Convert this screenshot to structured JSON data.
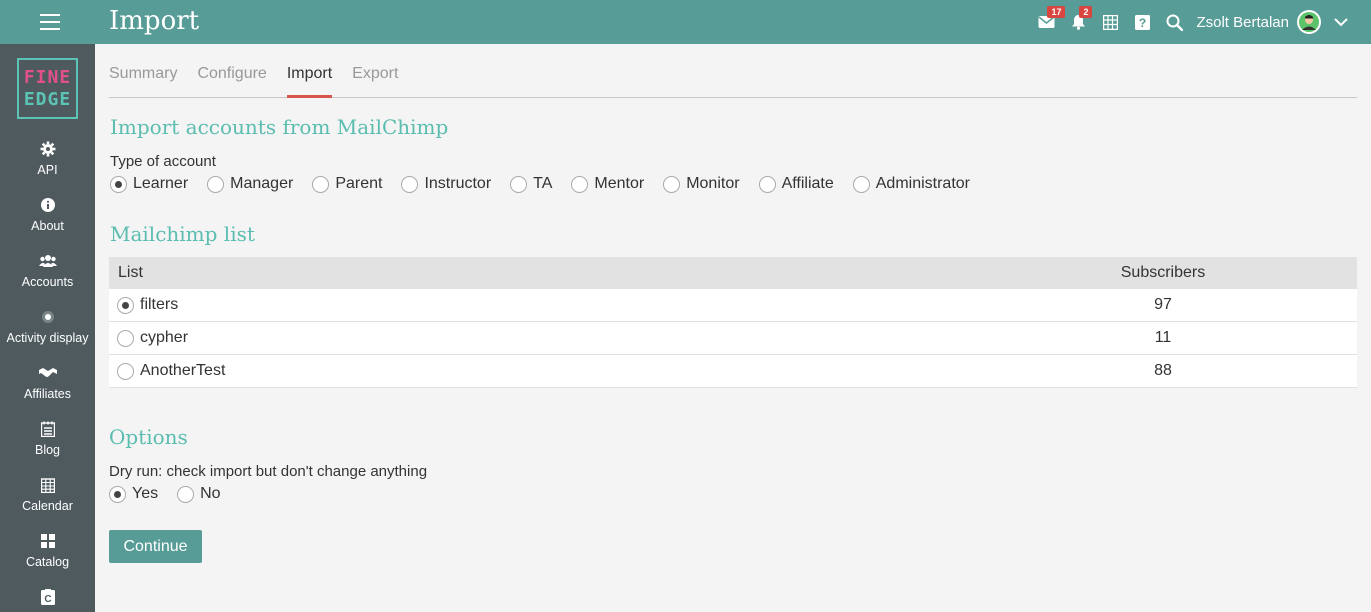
{
  "header": {
    "title": "Import",
    "mail_badge": "17",
    "notif_badge": "2",
    "user_name": "Zsolt Bertalan"
  },
  "colors": {
    "accent": "#579c96",
    "sidebar": "#4e5a5e",
    "section_title": "#5bbdb0",
    "badge": "#d9463f",
    "tab_underline": "#d9564d"
  },
  "logo": {
    "line1": "FINE",
    "line2": "EDGE"
  },
  "sidebar": {
    "items": [
      {
        "label": "API",
        "icon": "gear-icon"
      },
      {
        "label": "About",
        "icon": "info-icon"
      },
      {
        "label": "Accounts",
        "icon": "users-icon"
      },
      {
        "label": "Activity display",
        "icon": "dot-icon"
      },
      {
        "label": "Affiliates",
        "icon": "handshake-icon"
      },
      {
        "label": "Blog",
        "icon": "blog-icon"
      },
      {
        "label": "Calendar",
        "icon": "calendar-icon"
      },
      {
        "label": "Catalog",
        "icon": "grid-icon"
      }
    ]
  },
  "tabs": [
    {
      "label": "Summary"
    },
    {
      "label": "Configure"
    },
    {
      "label": "Import"
    },
    {
      "label": "Export"
    }
  ],
  "import_section": {
    "title": "Import accounts from MailChimp",
    "type_label": "Type of account",
    "types": [
      "Learner",
      "Manager",
      "Parent",
      "Instructor",
      "TA",
      "Mentor",
      "Monitor",
      "Affiliate",
      "Administrator"
    ],
    "selected": "Learner"
  },
  "mailchimp": {
    "title": "Mailchimp list",
    "col_list": "List",
    "col_subscribers": "Subscribers",
    "rows": [
      {
        "name": "filters",
        "subscribers": "97"
      },
      {
        "name": "cypher",
        "subscribers": "11"
      },
      {
        "name": "AnotherTest",
        "subscribers": "88"
      }
    ],
    "selected": "filters"
  },
  "options": {
    "title": "Options",
    "dry_run_label": "Dry run: check import but don't change anything",
    "yes": "Yes",
    "no": "No",
    "selected": "Yes"
  },
  "continue_label": "Continue"
}
